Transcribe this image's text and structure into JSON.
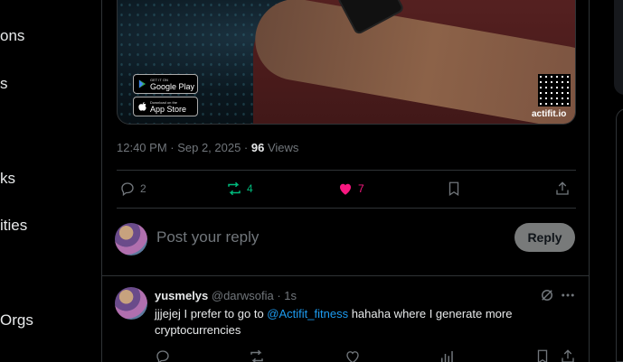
{
  "nav": {
    "items": [
      {
        "label": "ons"
      },
      {
        "label": "s"
      },
      {
        "label": "ks"
      },
      {
        "label": "ities"
      },
      {
        "label": "Orgs"
      }
    ]
  },
  "promo": {
    "google_play_small": "GET IT ON",
    "google_play_big": "Google Play",
    "app_store_small": "Download on the",
    "app_store_big": "App Store",
    "brand": "actifit.io"
  },
  "post": {
    "time": "12:40 PM · Sep 2, 2025 · ",
    "views_count": "96",
    "views_label": " Views",
    "replies": "2",
    "reposts": "4",
    "likes": "7"
  },
  "reply_box": {
    "placeholder": "Post your reply",
    "button": "Reply"
  },
  "reply": {
    "name": "yusmelys",
    "handle": " @darwsofia · 1s",
    "text_before": "jjjejej I prefer to go to ",
    "mention": "@Actifit_fitness",
    "text_after": "  hahaha where I generate more cryptocurrencies"
  },
  "colors": {
    "accent_blue": "#1d9bf0",
    "repost_green": "#00ba7c",
    "like_pink": "#f91880",
    "muted": "#71767b",
    "divider": "#2f3336"
  }
}
